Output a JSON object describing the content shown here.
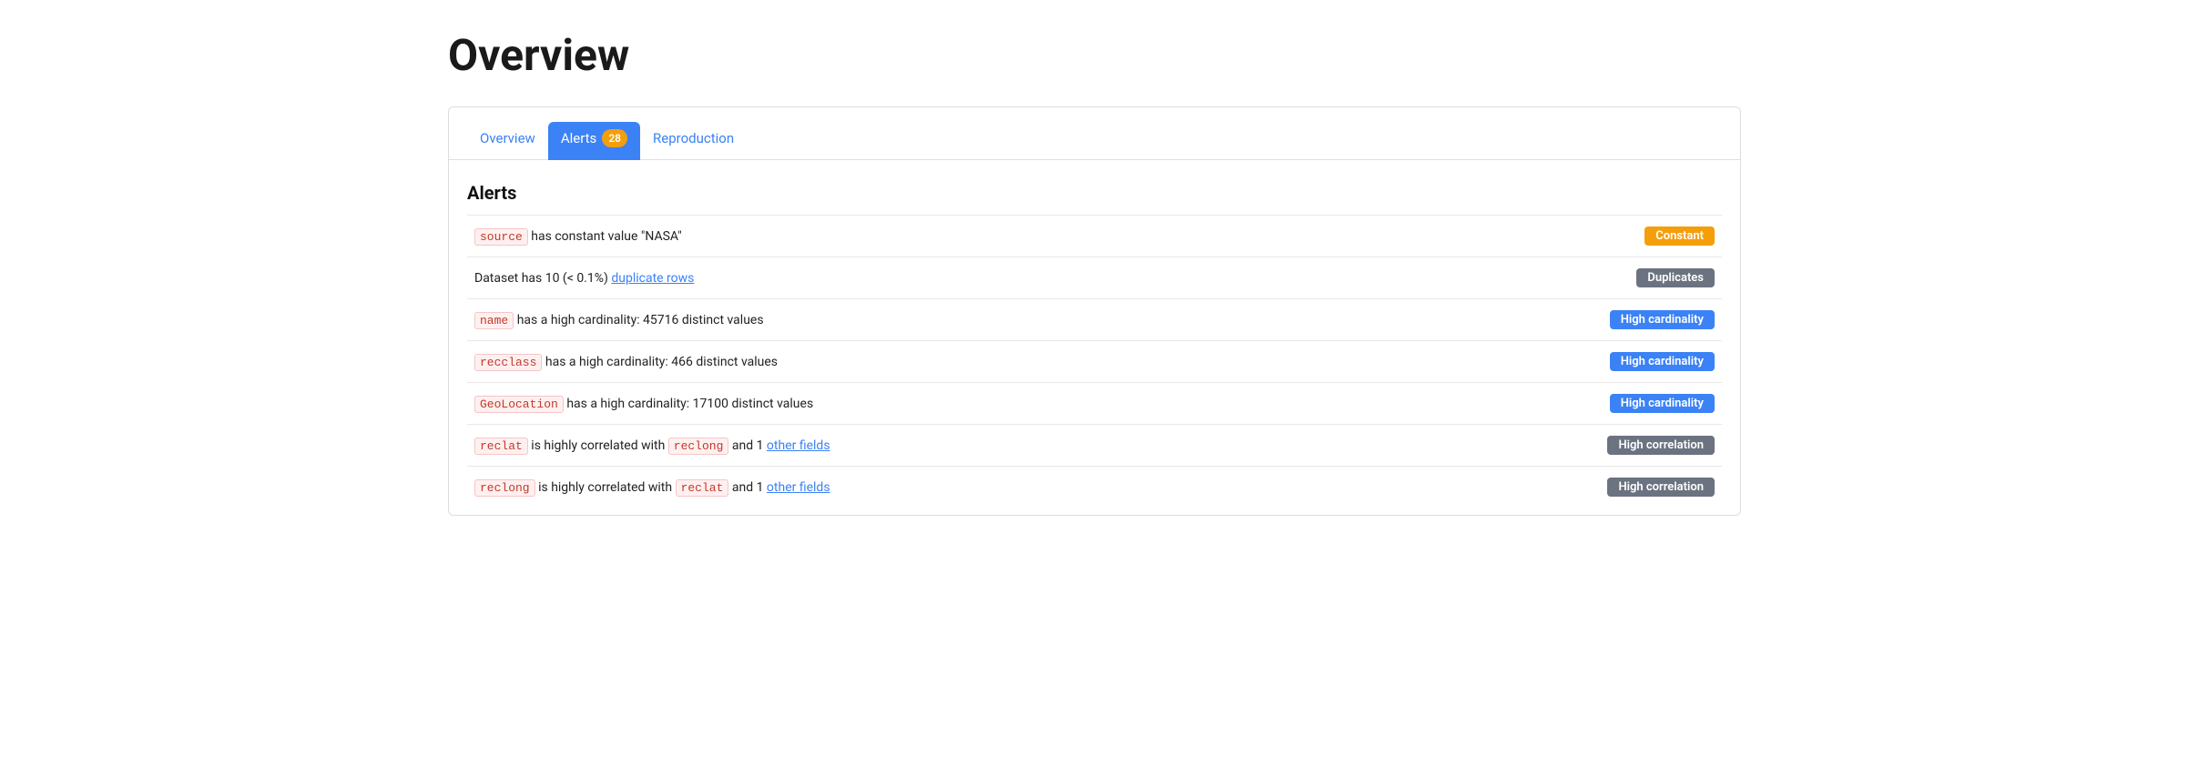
{
  "page": {
    "title": "Overview"
  },
  "tabs": [
    {
      "id": "overview",
      "label": "Overview",
      "active": false,
      "badge": null
    },
    {
      "id": "alerts",
      "label": "Alerts",
      "active": true,
      "badge": "28"
    },
    {
      "id": "reproduction",
      "label": "Reproduction",
      "active": false,
      "badge": null
    }
  ],
  "alerts_section": {
    "heading": "Alerts",
    "rows": [
      {
        "id": "row-source",
        "text_before": "",
        "code1": "source",
        "text_middle": " has constant value \"NASA\"",
        "code2": null,
        "text_after": null,
        "link": null,
        "badge_label": "Constant",
        "badge_class": "badge-constant"
      },
      {
        "id": "row-duplicates",
        "text_before": "Dataset has 10 (< 0.1%) ",
        "code1": null,
        "text_middle": null,
        "code2": null,
        "text_after": null,
        "link": "duplicate rows",
        "badge_label": "Duplicates",
        "badge_class": "badge-duplicates"
      },
      {
        "id": "row-name",
        "text_before": "",
        "code1": "name",
        "text_middle": "  has a high cardinality: 45716 distinct values",
        "code2": null,
        "text_after": null,
        "link": null,
        "badge_label": "High cardinality",
        "badge_class": "badge-high-cardinality"
      },
      {
        "id": "row-recclass",
        "text_before": "",
        "code1": "recclass",
        "text_middle": "  has a high cardinality: 466 distinct values",
        "code2": null,
        "text_after": null,
        "link": null,
        "badge_label": "High cardinality",
        "badge_class": "badge-high-cardinality"
      },
      {
        "id": "row-geolocation",
        "text_before": "",
        "code1": "GeoLocation",
        "text_middle": "  has a high cardinality: 17100 distinct values",
        "code2": null,
        "text_after": null,
        "link": null,
        "badge_label": "High cardinality",
        "badge_class": "badge-high-cardinality"
      },
      {
        "id": "row-reclat",
        "text_before": "",
        "code1": "reclat",
        "text_middle": "  is highly correlated with ",
        "code2": "reclong",
        "text_after": " and 1 other fields",
        "link": null,
        "badge_label": "High correlation",
        "badge_class": "badge-high-correlation"
      },
      {
        "id": "row-reclong",
        "text_before": "",
        "code1": "reclong",
        "text_middle": "  is highly correlated with ",
        "code2": "reclat",
        "text_after": " and 1 other fields",
        "link": null,
        "badge_label": "High correlation",
        "badge_class": "badge-high-correlation"
      }
    ]
  }
}
